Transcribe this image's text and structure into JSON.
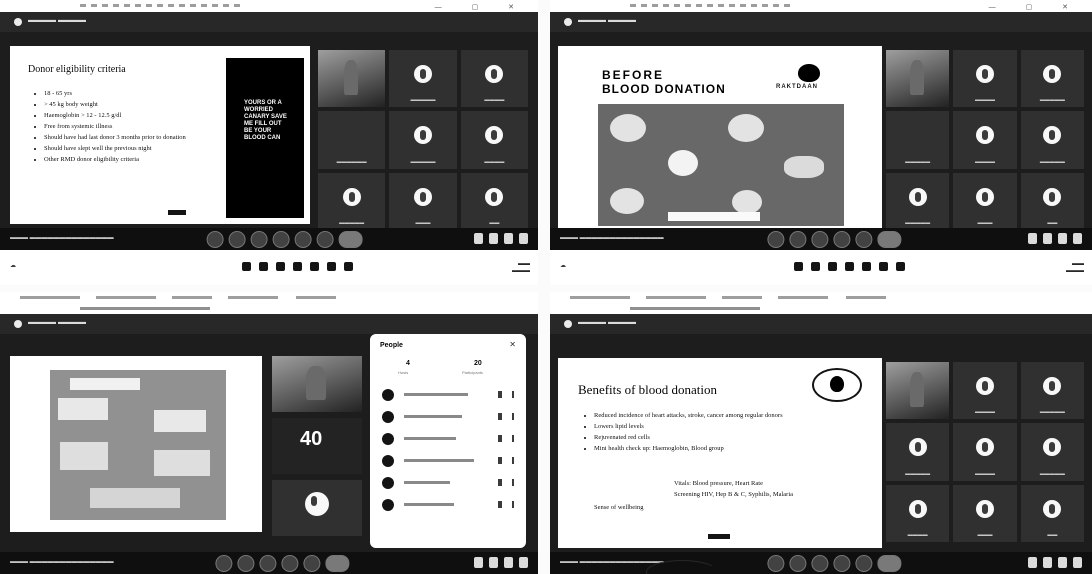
{
  "q1": {
    "slide_title": "Donor eligibility criteria",
    "bullets": [
      "18 - 65 yrs",
      "> 45 kg body weight",
      "Haemoglobin > 12 - 12.5 g/dl",
      "Free from systemic illness",
      "Should have had last donor 3 months prior to donation",
      "Should have slept well the previous night",
      "Other RMD donor eligibility criteria"
    ],
    "poster_text": "Yours Or A Worried Canary Save Me Fill Out Be YOUR Blood CAN"
  },
  "q2": {
    "title_line1": "BEFORE",
    "title_line2": "BLOOD DONATION",
    "brand": "RAKTDAAN"
  },
  "q3": {
    "panel_title": "People",
    "counts": [
      "4",
      "20"
    ],
    "count_labels": [
      "Hosts",
      "Participants"
    ],
    "tile_number": "40"
  },
  "q4": {
    "slide_title": "Benefits of blood donation",
    "bullets": [
      "Reduced incidence of heart attacks, stroke, cancer among regular donors",
      "Lowers lipid levels",
      "Rejuvenated red cells",
      "Mini health check up: Haemoglobin, Blood group"
    ],
    "sub_lines": [
      "Vitals: Blood pressure, Heart Rate",
      "Screening HIV, Hep B & C, Syphilis, Malaria"
    ],
    "last_bullet": "Sense of wellbeing"
  }
}
